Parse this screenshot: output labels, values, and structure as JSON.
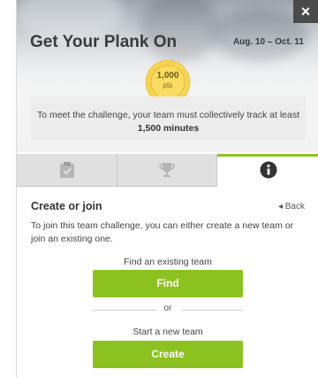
{
  "header": {
    "title": "Get Your Plank On",
    "dates": "Aug. 10 – Oct. 11",
    "close_label": "×"
  },
  "badge": {
    "points": "1,000",
    "unit": "pts"
  },
  "goal": {
    "text": "To meet the challenge, your team must collectively track at least",
    "target": "1,500 minutes"
  },
  "tabs": [
    {
      "name": "clipboard-check-icon",
      "active": false
    },
    {
      "name": "trophy-icon",
      "active": false
    },
    {
      "name": "info-icon",
      "active": true
    }
  ],
  "colors": {
    "accent": "#8cc21f",
    "tab_inactive": "#e0e0e0"
  },
  "content": {
    "section_title": "Create or join",
    "back_label": "◂ Back",
    "intro": "To join this team challenge, you can either create a new team or join an existing one.",
    "find_label": "Find an existing team",
    "find_button": "Find",
    "or_text": "or",
    "create_label": "Start a new team",
    "create_button": "Create"
  }
}
